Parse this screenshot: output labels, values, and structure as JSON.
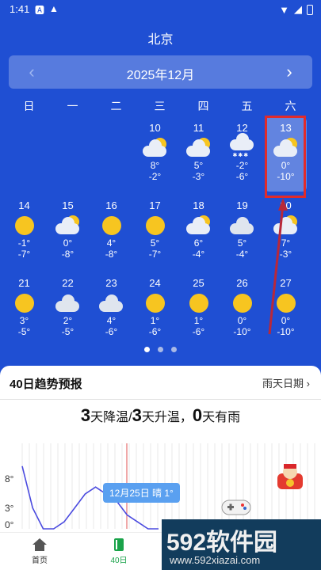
{
  "status": {
    "time": "1:41"
  },
  "header": {
    "city": "北京",
    "month": "2025年12月",
    "prev_icon": "chevron-left-icon",
    "next_icon": "chevron-right-icon"
  },
  "weekdays": [
    "日",
    "一",
    "二",
    "三",
    "四",
    "五",
    "六"
  ],
  "days": [
    {
      "day": "10",
      "hi": "8°",
      "lo": "-2°",
      "weather": "partly-cloudy"
    },
    {
      "day": "11",
      "hi": "5°",
      "lo": "-3°",
      "weather": "partly-cloudy"
    },
    {
      "day": "12",
      "hi": "-2°",
      "lo": "-6°",
      "weather": "snow"
    },
    {
      "day": "13",
      "hi": "0°",
      "lo": "-10°",
      "weather": "partly-cloudy",
      "selected": true
    },
    {
      "day": "14",
      "hi": "-1°",
      "lo": "-7°",
      "weather": "sunny"
    },
    {
      "day": "15",
      "hi": "0°",
      "lo": "-8°",
      "weather": "partly-cloudy"
    },
    {
      "day": "16",
      "hi": "4°",
      "lo": "-8°",
      "weather": "sunny"
    },
    {
      "day": "17",
      "hi": "5°",
      "lo": "-7°",
      "weather": "sunny"
    },
    {
      "day": "18",
      "hi": "6°",
      "lo": "-4°",
      "weather": "partly-cloudy"
    },
    {
      "day": "19",
      "hi": "5°",
      "lo": "-4°",
      "weather": "cloudy"
    },
    {
      "day": "20",
      "hi": "7°",
      "lo": "-3°",
      "weather": "partly-cloudy"
    },
    {
      "day": "21",
      "hi": "3°",
      "lo": "-5°",
      "weather": "sunny"
    },
    {
      "day": "22",
      "hi": "2°",
      "lo": "-5°",
      "weather": "cloudy"
    },
    {
      "day": "23",
      "hi": "4°",
      "lo": "-6°",
      "weather": "cloudy"
    },
    {
      "day": "24",
      "hi": "1°",
      "lo": "-6°",
      "weather": "sunny"
    },
    {
      "day": "25",
      "hi": "1°",
      "lo": "-6°",
      "weather": "sunny"
    },
    {
      "day": "26",
      "hi": "0°",
      "lo": "-10°",
      "weather": "sunny"
    },
    {
      "day": "27",
      "hi": "0°",
      "lo": "-10°",
      "weather": "sunny"
    }
  ],
  "trend": {
    "title": "40日趋势预报",
    "link": "雨天日期",
    "summary": {
      "n1": "3",
      "t1": "天降温/",
      "n2": "3",
      "t2": "天升温，",
      "n3": "0",
      "t3": "天有雨"
    },
    "y_ticks": [
      "8°",
      "3°",
      "0°"
    ],
    "tooltip": "12月25日 晴 1°"
  },
  "chart_data": {
    "type": "line",
    "series": [
      {
        "values": [
          8,
          2,
          -1,
          -1,
          0,
          2,
          4,
          5,
          4,
          3,
          1,
          0,
          -1,
          -1
        ]
      }
    ],
    "ylim": [
      -1,
      9
    ]
  },
  "tabbar": [
    {
      "label": "首页",
      "icon": "home-icon"
    },
    {
      "label": "40日",
      "icon": "calendar-book-icon",
      "active": true
    }
  ],
  "watermark": {
    "brand": "592软件园",
    "url": "www.592xiazai.com"
  },
  "colors": {
    "background": "#1f4fd3",
    "highlight_box": "#e12b2b",
    "active_tab": "#1aa34a",
    "tooltip": "#5aa0f0"
  }
}
